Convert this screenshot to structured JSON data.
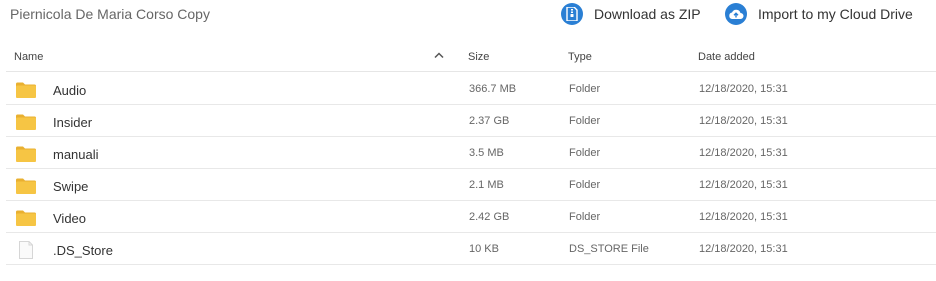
{
  "header": {
    "title": "Piernicola De Maria Corso Copy",
    "download_zip_label": "Download as ZIP",
    "import_cloud_label": "Import to my Cloud Drive"
  },
  "columns": {
    "name": "Name",
    "size": "Size",
    "type": "Type",
    "date": "Date added"
  },
  "rows": [
    {
      "icon": "folder-icon",
      "name": "Audio",
      "size": "366.7 MB",
      "type": "Folder",
      "date": "12/18/2020, 15:31"
    },
    {
      "icon": "folder-icon",
      "name": "Insider",
      "size": "2.37 GB",
      "type": "Folder",
      "date": "12/18/2020, 15:31"
    },
    {
      "icon": "folder-icon",
      "name": "manuali",
      "size": "3.5 MB",
      "type": "Folder",
      "date": "12/18/2020, 15:31"
    },
    {
      "icon": "folder-icon",
      "name": "Swipe",
      "size": "2.1 MB",
      "type": "Folder",
      "date": "12/18/2020, 15:31"
    },
    {
      "icon": "folder-icon",
      "name": "Video",
      "size": "2.42 GB",
      "type": "Folder",
      "date": "12/18/2020, 15:31"
    },
    {
      "icon": "file-icon",
      "name": ".DS_Store",
      "size": "10 KB",
      "type": "DS_STORE File",
      "date": "12/18/2020, 15:31"
    }
  ],
  "colors": {
    "accent": "#2a7fd4",
    "folder": "#f6c544",
    "folder_dark": "#e9b030"
  }
}
